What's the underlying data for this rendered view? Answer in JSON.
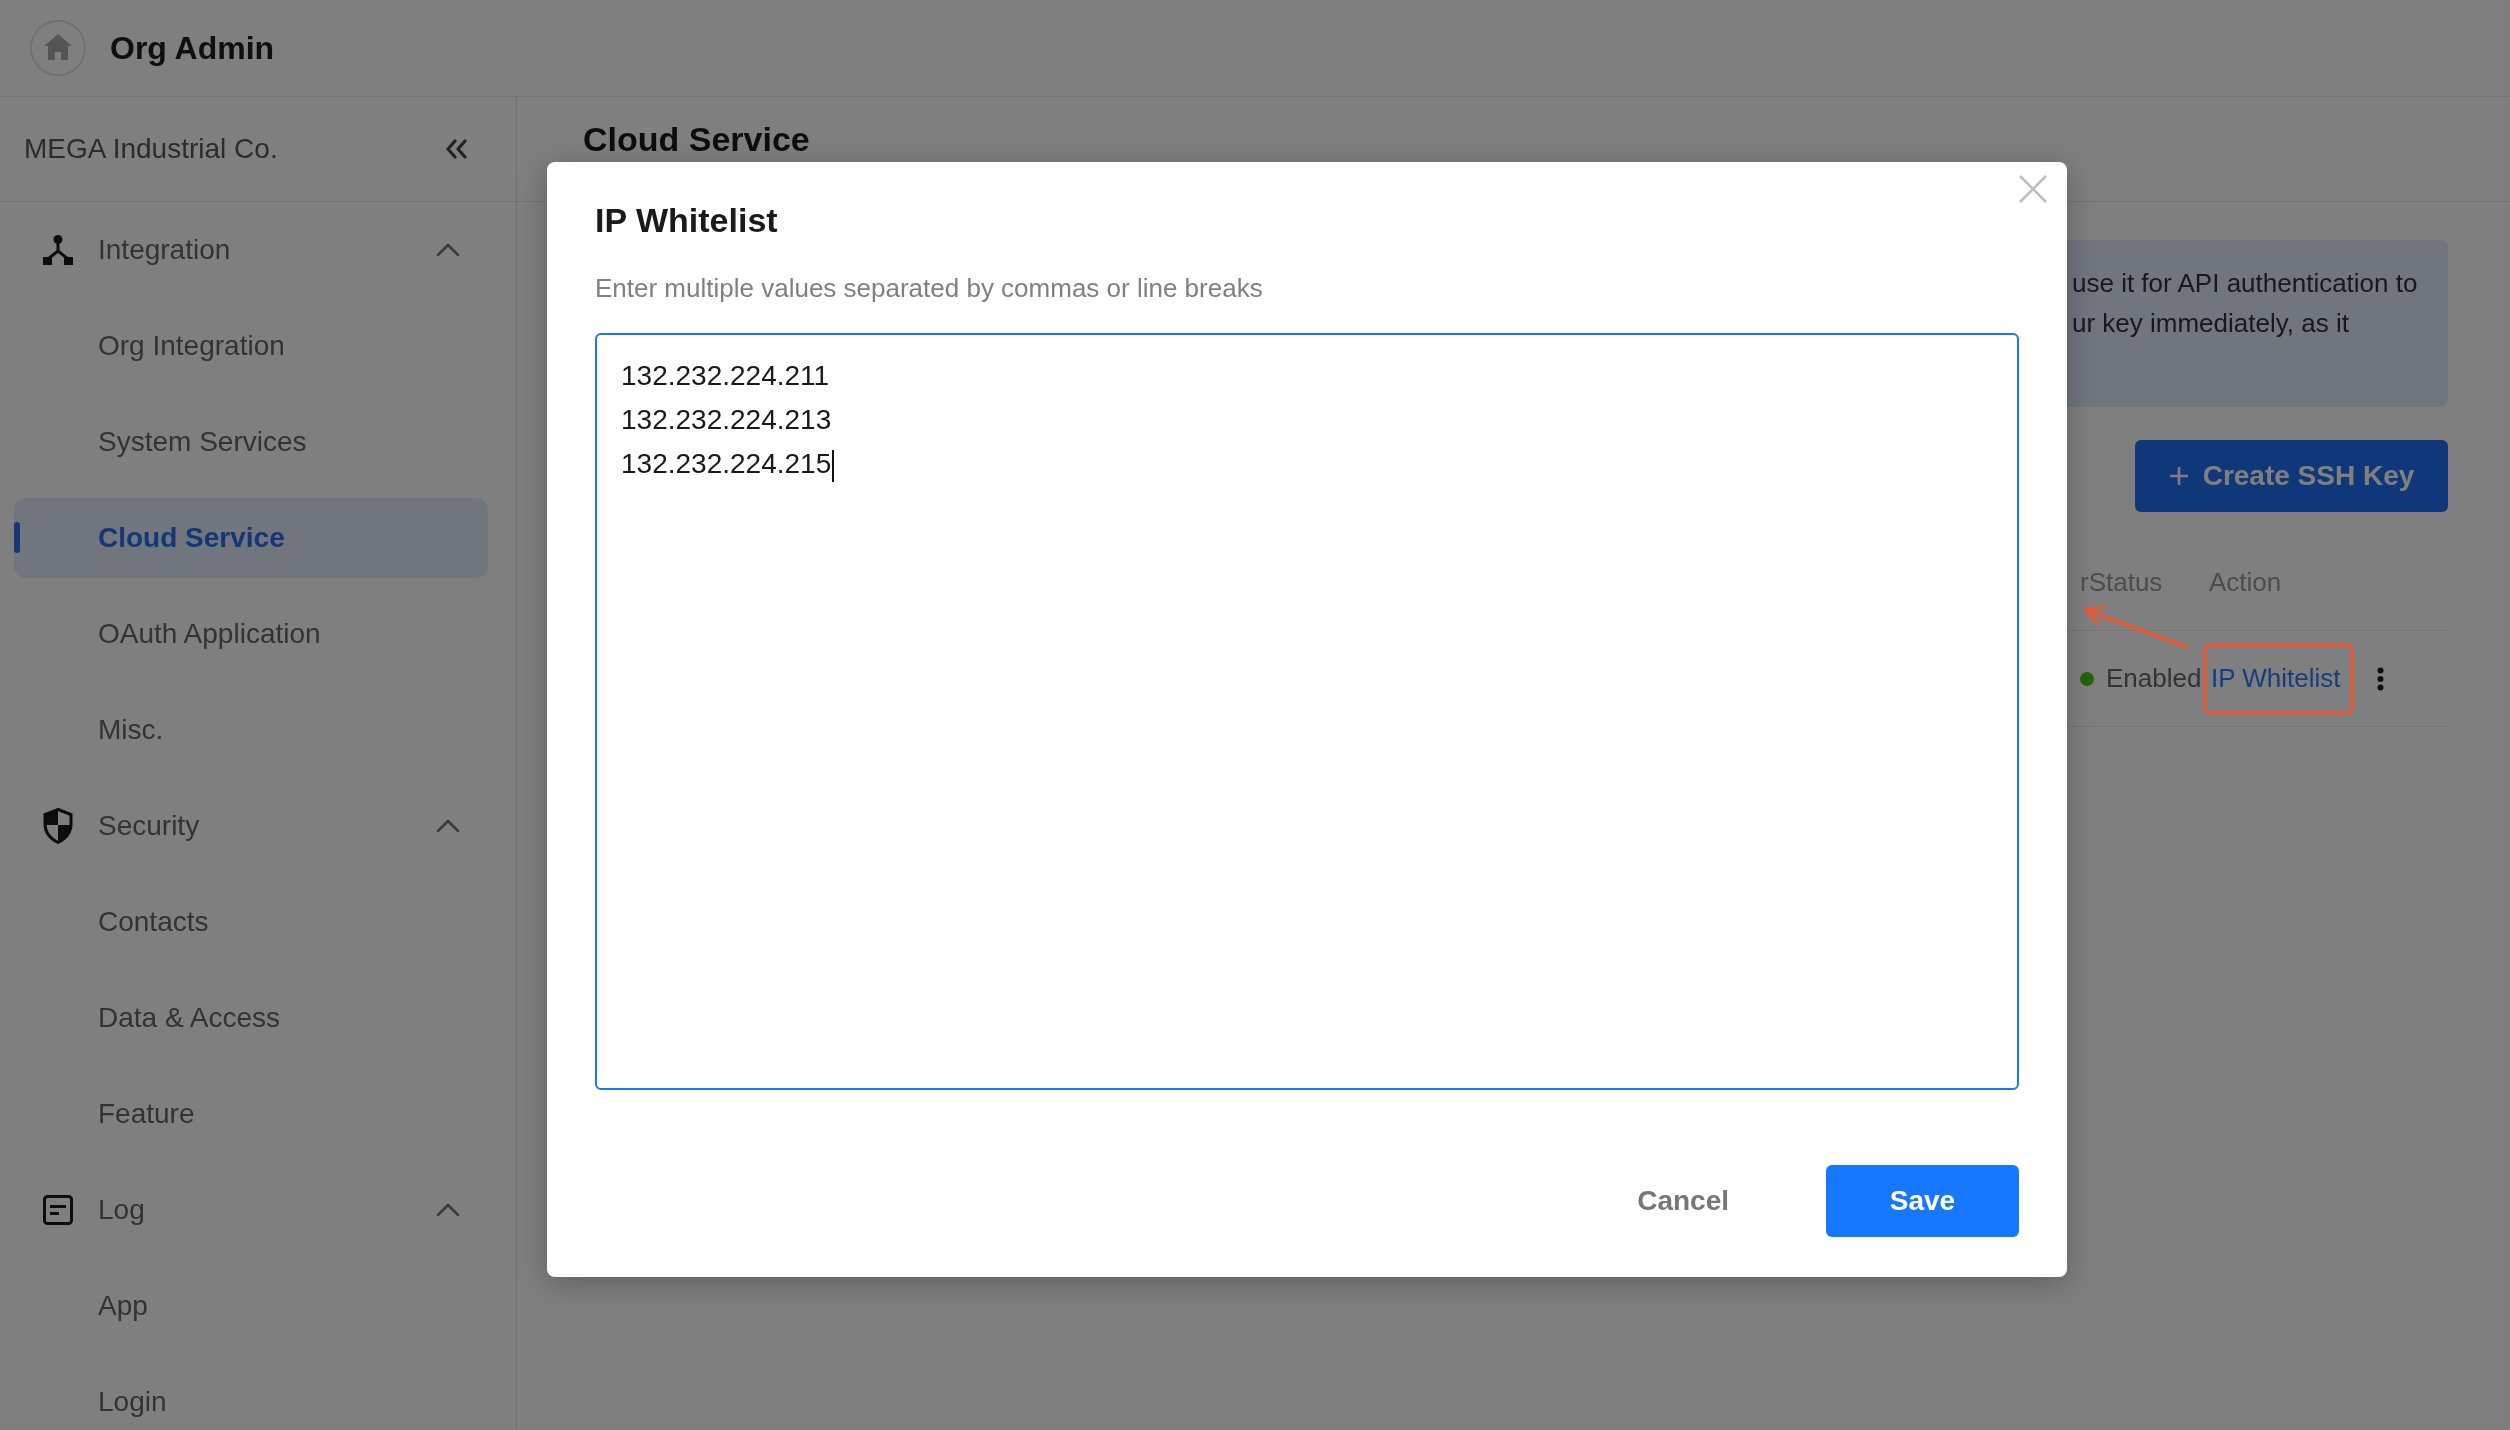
{
  "header": {
    "title": "Org Admin"
  },
  "sidebar": {
    "org_name": "MEGA Industrial Co.",
    "groups": [
      {
        "label": "Integration",
        "expanded": true,
        "children": [
          {
            "label": "Org Integration",
            "selected": false
          },
          {
            "label": "System Services",
            "selected": false
          },
          {
            "label": "Cloud Service",
            "selected": true
          },
          {
            "label": "OAuth Application",
            "selected": false
          },
          {
            "label": "Misc.",
            "selected": false
          }
        ]
      },
      {
        "label": "Security",
        "expanded": true,
        "children": [
          {
            "label": "Contacts",
            "selected": false
          },
          {
            "label": "Data & Access",
            "selected": false
          },
          {
            "label": "Feature",
            "selected": false
          }
        ]
      },
      {
        "label": "Log",
        "expanded": true,
        "children": [
          {
            "label": "App",
            "selected": false
          },
          {
            "label": "Login",
            "selected": false
          }
        ]
      }
    ]
  },
  "page": {
    "title": "Cloud Service",
    "notice": {
      "lines": [
        "use it for API authentication to",
        "ur key immediately, as it"
      ]
    },
    "create_button": {
      "label": "Create SSH Key"
    },
    "table": {
      "columns": [
        "rStatus",
        "Action"
      ],
      "rows": [
        {
          "status": "Enabled",
          "action": "IP Whitelist",
          "highlighted": true
        }
      ]
    }
  },
  "modal": {
    "title": "IP Whitelist",
    "hint": "Enter multiple values separated by commas or line breaks",
    "field": {
      "value": "132.232.224.211\n132.232.224.213\n132.232.224.215",
      "focused": true
    },
    "buttons": [
      {
        "label": "Cancel",
        "kind": "secondary"
      },
      {
        "label": "Save",
        "kind": "primary"
      }
    ]
  }
}
